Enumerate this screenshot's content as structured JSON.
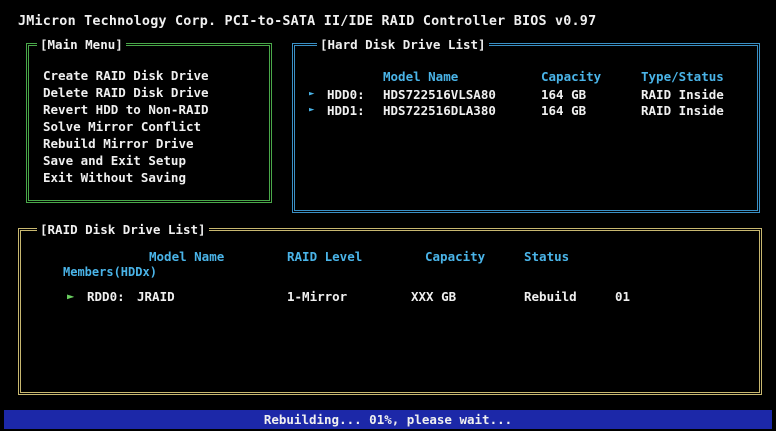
{
  "title": "JMicron Technology Corp. PCI-to-SATA II/IDE RAID Controller BIOS v0.97",
  "main_menu": {
    "legend": "[Main Menu]",
    "items": [
      "Create RAID Disk Drive",
      "Delete RAID Disk Drive",
      "Revert HDD to Non-RAID",
      "Solve Mirror Conflict",
      "Rebuild Mirror Drive",
      "Save and Exit Setup",
      "Exit Without Saving"
    ]
  },
  "hdd_list": {
    "legend": "[Hard Disk Drive List]",
    "headers": {
      "model": "Model Name",
      "capacity": "Capacity",
      "type": "Type/Status"
    },
    "rows": [
      {
        "arrow": "►",
        "device": "HDD0:",
        "model": "HDS722516VLSA80",
        "capacity": "164 GB",
        "type": "RAID Inside"
      },
      {
        "arrow": "►",
        "device": "HDD1:",
        "model": "HDS722516DLA380",
        "capacity": "164 GB",
        "type": "RAID Inside"
      }
    ]
  },
  "raid_list": {
    "legend": "[RAID Disk Drive List]",
    "headers": {
      "model": "Model Name",
      "level": "RAID Level",
      "capacity": "Capacity",
      "status": "Status"
    },
    "members_label": "Members(HDDx)",
    "rows": [
      {
        "arrow": "►",
        "id": "RDD0:",
        "name": "JRAID",
        "level": "1-Mirror",
        "capacity": "XXX GB",
        "status": "Rebuild",
        "progress": "01"
      }
    ]
  },
  "status_bar": {
    "text": "Rebuilding... 01%, please wait..."
  },
  "colors": {
    "background": "#000000",
    "main_menu_border": "#4aa84a",
    "hdd_border": "#3a8fc4",
    "raid_border": "#c8b870",
    "header_text": "#4ab4e8",
    "status_bar_bg": "#1c28a8"
  }
}
